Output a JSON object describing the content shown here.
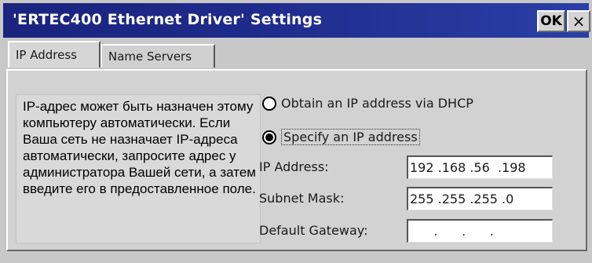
{
  "window": {
    "title": "'ERTEC400 Ethernet Driver' Settings",
    "ok_label": "OK",
    "close_label": "×"
  },
  "tabs": [
    {
      "label": "IP Address",
      "active": true
    },
    {
      "label": "Name Servers",
      "active": false
    }
  ],
  "info_text": "IP-адрес может быть назначен этому компьютеру автоматически. Если Ваша сеть не назначает IP-адреса автоматически, запросите адрес у администратора Вашей сети, а затем введите его в предоставленное поле.",
  "options": {
    "dhcp_label": "Obtain an IP address via DHCP",
    "specify_label": "Specify an IP address",
    "selected": "specify"
  },
  "fields": {
    "ip_label": "IP Address:",
    "ip_value": "192 .168 .56  .198",
    "mask_label": "Subnet Mask:",
    "mask_value": "255 .255 .255 .0",
    "gateway_label": "Default Gateway:",
    "gateway_value": "      .      .      ."
  }
}
